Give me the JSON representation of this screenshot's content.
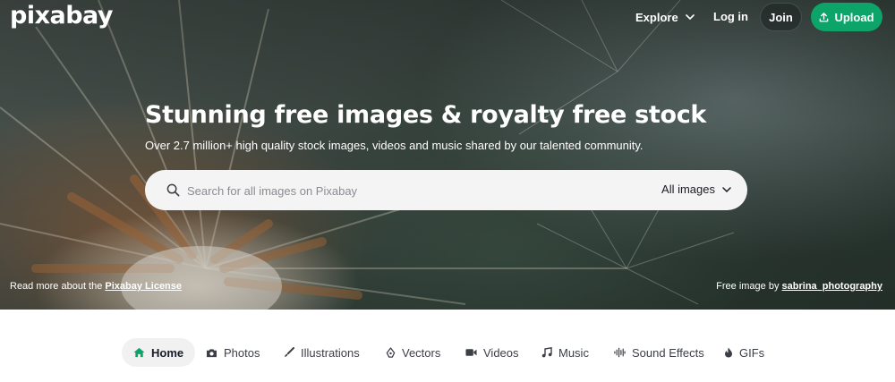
{
  "brand": {
    "logo_text": "pixabay"
  },
  "nav": {
    "explore_label": "Explore",
    "login_label": "Log in",
    "join_label": "Join",
    "upload_label": "Upload",
    "upload_color": "#0da46a"
  },
  "hero": {
    "title": "Stunning free images & royalty free stock",
    "subtitle": "Over 2.7 million+ high quality stock images, videos and music shared by our talented community.",
    "search": {
      "placeholder": "Search for all images on Pixabay",
      "value": "",
      "type_selected": "All images"
    },
    "license_prefix": "Read more about the ",
    "license_link": "Pixabay License",
    "credit_prefix": "Free image by ",
    "credit_link": "sabrina_photography"
  },
  "tabs": [
    {
      "label": "Home",
      "icon": "home-icon",
      "active": true
    },
    {
      "label": "Photos",
      "icon": "camera-icon",
      "active": false
    },
    {
      "label": "Illustrations",
      "icon": "brush-icon",
      "active": false
    },
    {
      "label": "Vectors",
      "icon": "pen-nib-icon",
      "active": false
    },
    {
      "label": "Videos",
      "icon": "video-camera-icon",
      "active": false
    },
    {
      "label": "Music",
      "icon": "music-note-icon",
      "active": false
    },
    {
      "label": "Sound Effects",
      "icon": "sound-wave-icon",
      "active": false
    },
    {
      "label": "GIFs",
      "icon": "flame-icon",
      "active": false
    }
  ],
  "colors": {
    "accent": "#0da46a",
    "text_dark": "#191b26",
    "tab_active_bg": "#f1f1f1"
  }
}
